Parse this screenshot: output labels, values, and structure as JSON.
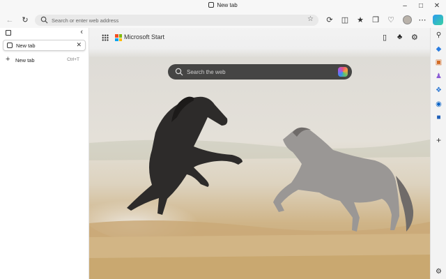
{
  "window": {
    "title": "New tab"
  },
  "toolbar": {
    "address_placeholder": "Search or enter web address"
  },
  "vertical_tabs": {
    "tabs": [
      {
        "label": "New tab"
      }
    ],
    "new_tab": {
      "label": "New tab",
      "shortcut": "Ctrl+T"
    }
  },
  "ntp": {
    "brand": "Microsoft Start",
    "search_placeholder": "Search the web"
  },
  "colors": {
    "accent": "#0a6cd6",
    "search_bg": "#373737"
  },
  "icons": {
    "sidebar": [
      "search-icon",
      "tag-icon",
      "briefcase-icon",
      "games-icon",
      "office-icon",
      "outlook-icon",
      "word-icon",
      "add-icon",
      "settings-icon"
    ]
  }
}
